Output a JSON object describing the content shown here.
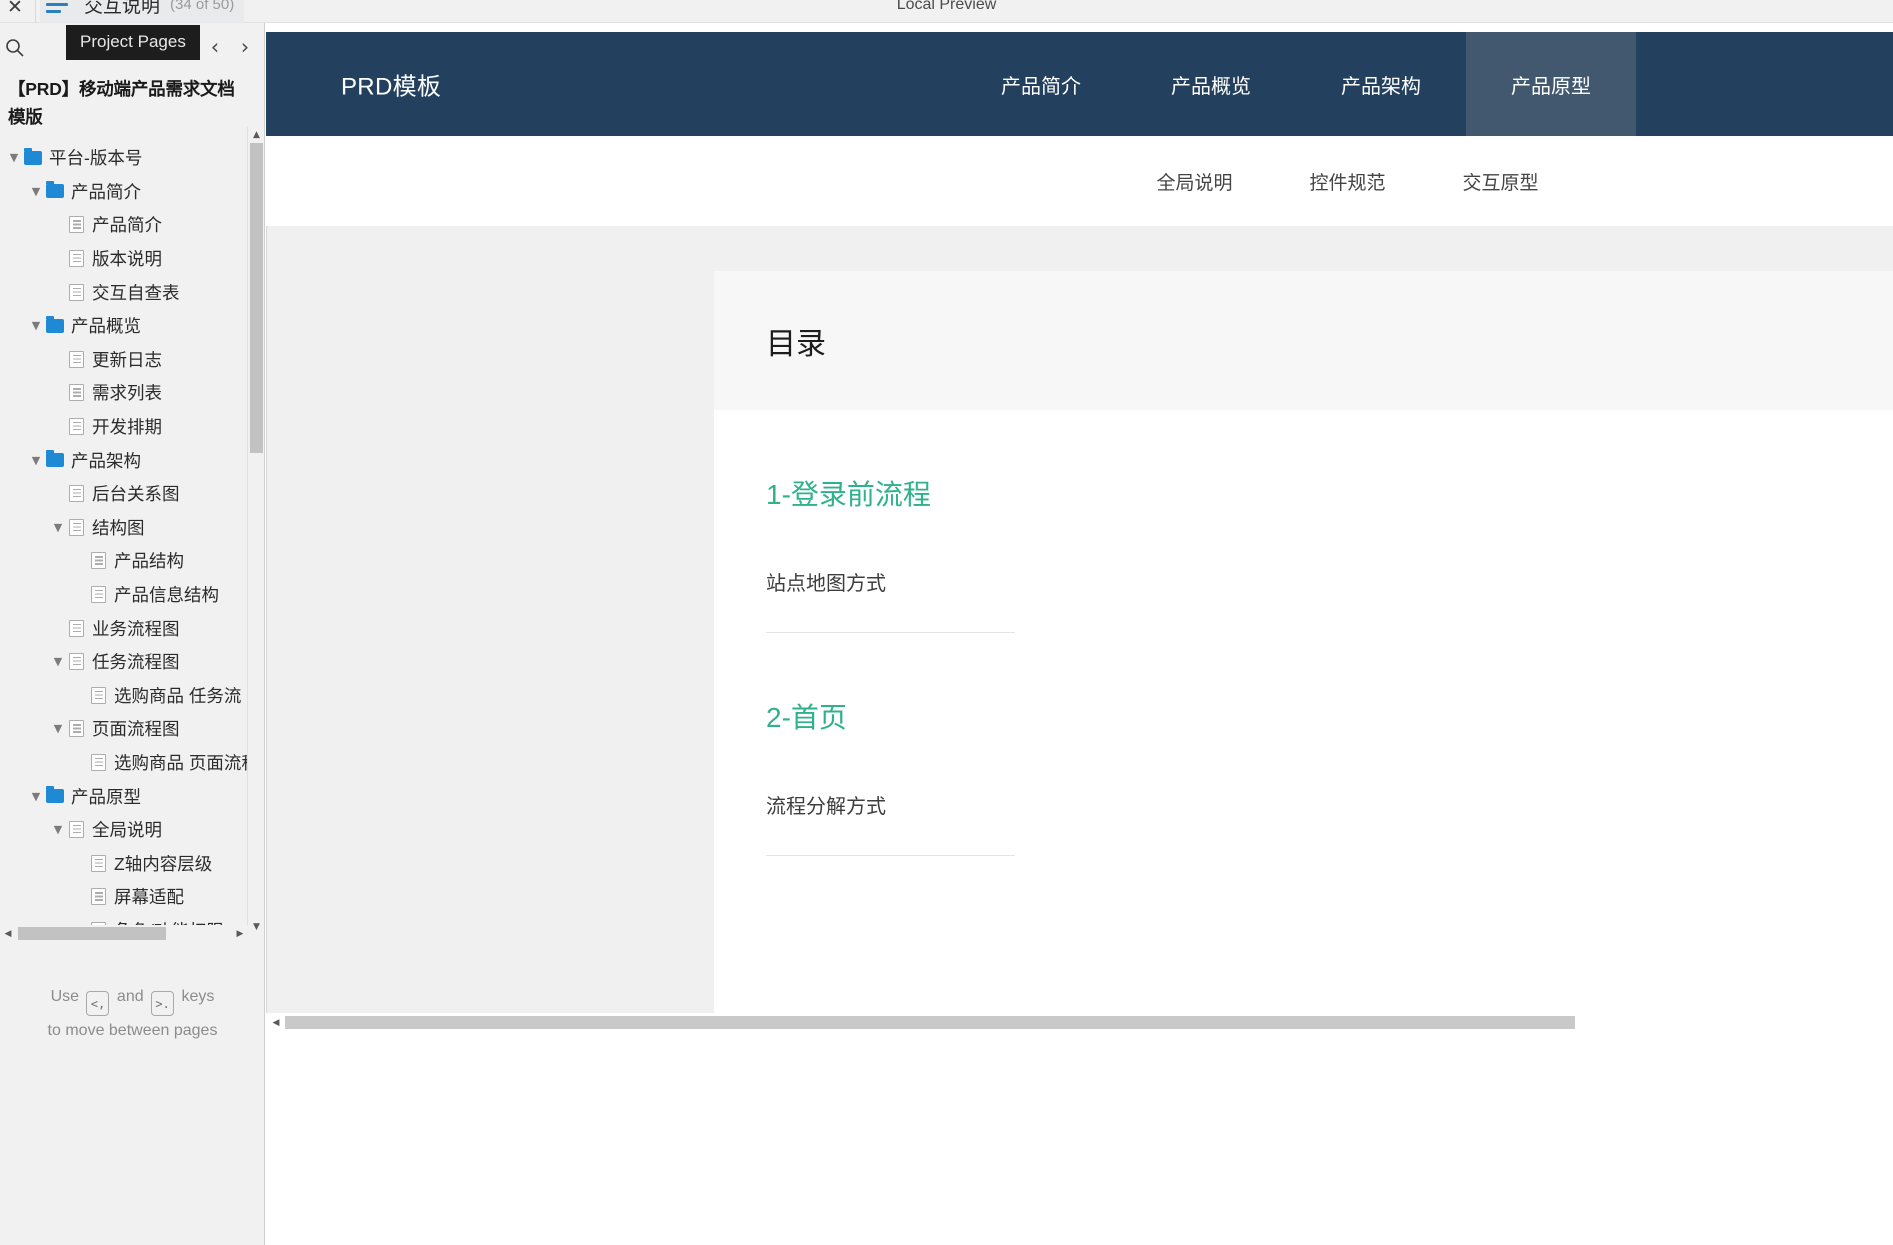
{
  "topbar": {
    "close_icon": "close-icon",
    "menu_icon": "hamburger-menu-icon",
    "page_title": "交互说明",
    "page_count": "(34 of 50)",
    "window_title": "Local Preview"
  },
  "tooltip": {
    "text": "Project Pages"
  },
  "sidebar": {
    "search_icon": "search-icon",
    "prev_icon": "chevron-left-icon",
    "next_icon": "chevron-right-icon",
    "project_title": "【PRD】移动端产品需求文档模版",
    "tree": [
      {
        "label": "平台-版本号",
        "depth": 0,
        "icon": "folder",
        "caret": "down"
      },
      {
        "label": "产品简介",
        "depth": 1,
        "icon": "folder",
        "caret": "down"
      },
      {
        "label": "产品简介",
        "depth": 2,
        "icon": "page",
        "caret": "none"
      },
      {
        "label": "版本说明",
        "depth": 2,
        "icon": "page",
        "caret": "none"
      },
      {
        "label": "交互自查表",
        "depth": 2,
        "icon": "page",
        "caret": "none"
      },
      {
        "label": "产品概览",
        "depth": 1,
        "icon": "folder",
        "caret": "down"
      },
      {
        "label": "更新日志",
        "depth": 2,
        "icon": "page",
        "caret": "none"
      },
      {
        "label": "需求列表",
        "depth": 2,
        "icon": "page",
        "caret": "none"
      },
      {
        "label": "开发排期",
        "depth": 2,
        "icon": "page",
        "caret": "none"
      },
      {
        "label": "产品架构",
        "depth": 1,
        "icon": "folder",
        "caret": "down"
      },
      {
        "label": "后台关系图",
        "depth": 2,
        "icon": "page",
        "caret": "none"
      },
      {
        "label": "结构图",
        "depth": 2,
        "icon": "page",
        "caret": "down"
      },
      {
        "label": "产品结构",
        "depth": 3,
        "icon": "page",
        "caret": "none"
      },
      {
        "label": "产品信息结构",
        "depth": 3,
        "icon": "page",
        "caret": "none"
      },
      {
        "label": "业务流程图",
        "depth": 2,
        "icon": "page",
        "caret": "none"
      },
      {
        "label": "任务流程图",
        "depth": 2,
        "icon": "page",
        "caret": "down"
      },
      {
        "label": "选购商品 任务流",
        "depth": 3,
        "icon": "page",
        "caret": "none"
      },
      {
        "label": "页面流程图",
        "depth": 2,
        "icon": "page",
        "caret": "down"
      },
      {
        "label": "选购商品 页面流程",
        "depth": 3,
        "icon": "page",
        "caret": "none"
      },
      {
        "label": "产品原型",
        "depth": 1,
        "icon": "folder",
        "caret": "down"
      },
      {
        "label": "全局说明",
        "depth": 2,
        "icon": "page",
        "caret": "down"
      },
      {
        "label": "Z轴内容层级",
        "depth": 3,
        "icon": "page",
        "caret": "none"
      },
      {
        "label": "屏幕适配",
        "depth": 3,
        "icon": "page",
        "caret": "none"
      },
      {
        "label": "角色/功能权限",
        "depth": 3,
        "icon": "page",
        "caret": "none"
      }
    ],
    "hint": {
      "prefix": "Use",
      "key1": "<,",
      "middle": "and",
      "key2": ">.",
      "suffix": "keys",
      "line2": "to move between pages"
    }
  },
  "prototype": {
    "brand": "PRD模板",
    "nav_items": [
      {
        "label": "产品简介",
        "active": false
      },
      {
        "label": "产品概览",
        "active": false
      },
      {
        "label": "产品架构",
        "active": false
      },
      {
        "label": "产品原型",
        "active": true
      }
    ],
    "subnav_items": [
      {
        "label": "全局说明"
      },
      {
        "label": "控件规范"
      },
      {
        "label": "交互原型"
      }
    ],
    "card": {
      "heading": "目录",
      "sections": [
        {
          "title": "1-登录前流程",
          "link": "站点地图方式"
        },
        {
          "title": "2-首页",
          "link": "流程分解方式"
        }
      ]
    }
  },
  "colors": {
    "nav_bg": "#23415e",
    "nav_active_bg": "#41586f",
    "accent_green": "#2fb289",
    "folder_blue": "#1e8ad6",
    "chrome_gray": "#f1f1f1"
  }
}
